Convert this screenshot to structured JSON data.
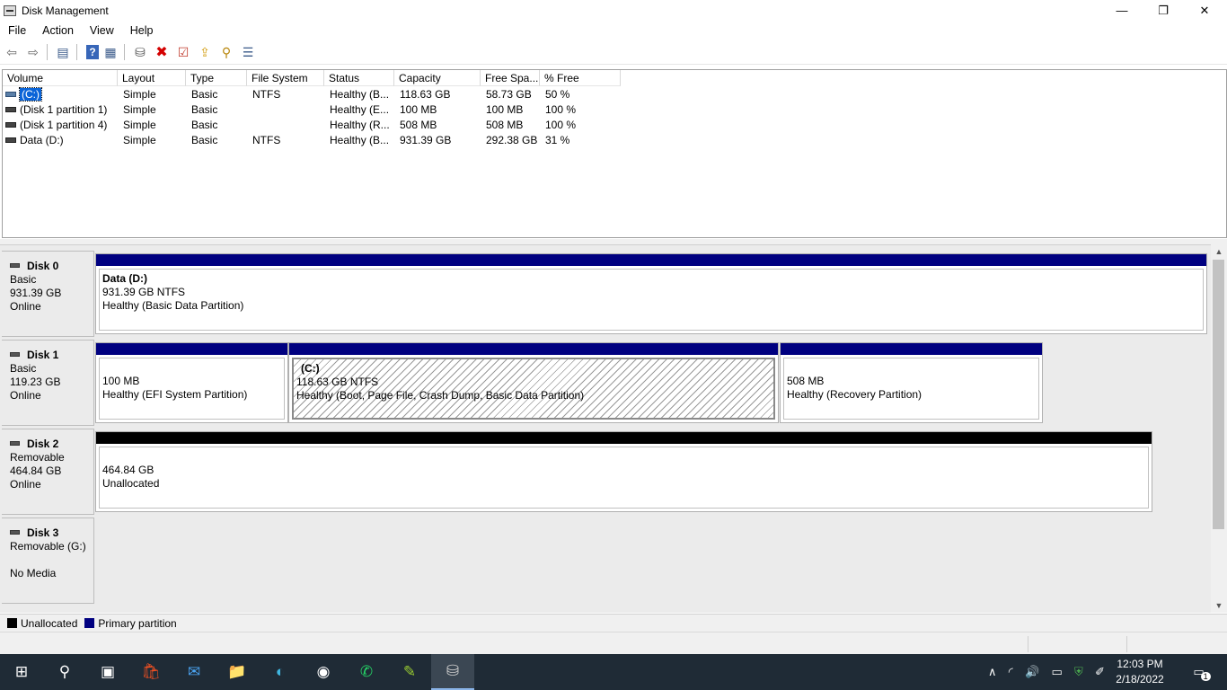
{
  "window": {
    "title": "Disk Management",
    "controls": {
      "minimize": "—",
      "restore": "❐",
      "close": "✕"
    }
  },
  "menu": [
    "File",
    "Action",
    "View",
    "Help"
  ],
  "toolbar": [
    {
      "name": "back-icon",
      "glyph": "⇦"
    },
    {
      "name": "forward-icon",
      "glyph": "⇨"
    },
    {
      "name": "show-hide-console-tree-icon",
      "glyph": "▤"
    },
    {
      "name": "help-icon",
      "glyph": "?"
    },
    {
      "name": "properties-icon",
      "glyph": "▦"
    },
    {
      "name": "connect-disk-icon",
      "glyph": "⛁"
    },
    {
      "name": "delete-icon",
      "glyph": "✖"
    },
    {
      "name": "check-icon",
      "glyph": "☑"
    },
    {
      "name": "export-list-icon",
      "glyph": "⇪"
    },
    {
      "name": "search-icon",
      "glyph": "⚲"
    },
    {
      "name": "view-icon",
      "glyph": "☰"
    }
  ],
  "volumes": {
    "columns": [
      "Volume",
      "Layout",
      "Type",
      "File System",
      "Status",
      "Capacity",
      "Free Spa...",
      "% Free"
    ],
    "rows": [
      {
        "volume": "(C:)",
        "layout": "Simple",
        "type": "Basic",
        "fs": "NTFS",
        "status": "Healthy (B...",
        "capacity": "118.63 GB",
        "free": "58.73 GB",
        "pct": "50 %",
        "selected": true
      },
      {
        "volume": "(Disk 1 partition 1)",
        "layout": "Simple",
        "type": "Basic",
        "fs": "",
        "status": "Healthy (E...",
        "capacity": "100 MB",
        "free": "100 MB",
        "pct": "100 %"
      },
      {
        "volume": "(Disk 1 partition 4)",
        "layout": "Simple",
        "type": "Basic",
        "fs": "",
        "status": "Healthy (R...",
        "capacity": "508 MB",
        "free": "508 MB",
        "pct": "100 %"
      },
      {
        "volume": "Data (D:)",
        "layout": "Simple",
        "type": "Basic",
        "fs": "NTFS",
        "status": "Healthy (B...",
        "capacity": "931.39 GB",
        "free": "292.38 GB",
        "pct": "31 %"
      }
    ]
  },
  "disks": [
    {
      "name": "Disk 0",
      "kind": "Basic",
      "size": "931.39 GB",
      "state": "Online",
      "partitions": [
        {
          "title": "Data  (D:)",
          "size": "931.39 GB NTFS",
          "status": "Healthy (Basic Data Partition)",
          "color": "#000080"
        }
      ]
    },
    {
      "name": "Disk 1",
      "kind": "Basic",
      "size": "119.23 GB",
      "state": "Online",
      "partitions": [
        {
          "title": "",
          "size": "100 MB",
          "status": "Healthy (EFI System Partition)",
          "color": "#000080"
        },
        {
          "title": "(C:)",
          "size": "118.63 GB NTFS",
          "status": "Healthy (Boot, Page File, Crash Dump, Basic Data Partition)",
          "color": "#000080",
          "selected": true
        },
        {
          "title": "",
          "size": "508 MB",
          "status": "Healthy (Recovery Partition)",
          "color": "#000080"
        }
      ]
    },
    {
      "name": "Disk 2",
      "kind": "Removable",
      "size": "464.84 GB",
      "state": "Online",
      "partitions": [
        {
          "title": "",
          "size": "464.84 GB",
          "status": "Unallocated",
          "color": "#000000"
        }
      ]
    },
    {
      "name": "Disk 3",
      "kind": "Removable (G:)",
      "size": "",
      "state": "No Media",
      "partitions": []
    }
  ],
  "legend": [
    {
      "label": "Unallocated",
      "color": "#000000"
    },
    {
      "label": "Primary partition",
      "color": "#000080"
    }
  ],
  "taskbar": {
    "apps": [
      {
        "name": "start-icon",
        "glyph": "⊞"
      },
      {
        "name": "search-icon",
        "glyph": "⚲"
      },
      {
        "name": "task-view-icon",
        "glyph": "▣"
      },
      {
        "name": "microsoft-store-icon",
        "glyph": "🛍"
      },
      {
        "name": "mail-icon",
        "glyph": "✉"
      },
      {
        "name": "file-explorer-icon",
        "glyph": "📁"
      },
      {
        "name": "edge-icon",
        "glyph": "◐"
      },
      {
        "name": "steam-icon",
        "glyph": "◉"
      },
      {
        "name": "whatsapp-icon",
        "glyph": "✆"
      },
      {
        "name": "notepad-plus-icon",
        "glyph": "✎"
      },
      {
        "name": "disk-management-icon",
        "glyph": "⛁",
        "active": true
      }
    ],
    "tray": [
      {
        "name": "show-hidden-icons-icon",
        "glyph": "∧"
      },
      {
        "name": "network-icon",
        "glyph": "◜"
      },
      {
        "name": "volume-icon",
        "glyph": "🔊"
      },
      {
        "name": "battery-icon",
        "glyph": "▭"
      },
      {
        "name": "security-icon",
        "glyph": "⛨"
      },
      {
        "name": "pen-icon",
        "glyph": "✐"
      }
    ],
    "time": "12:03 PM",
    "date": "2/18/2022",
    "notification_count": "1"
  }
}
